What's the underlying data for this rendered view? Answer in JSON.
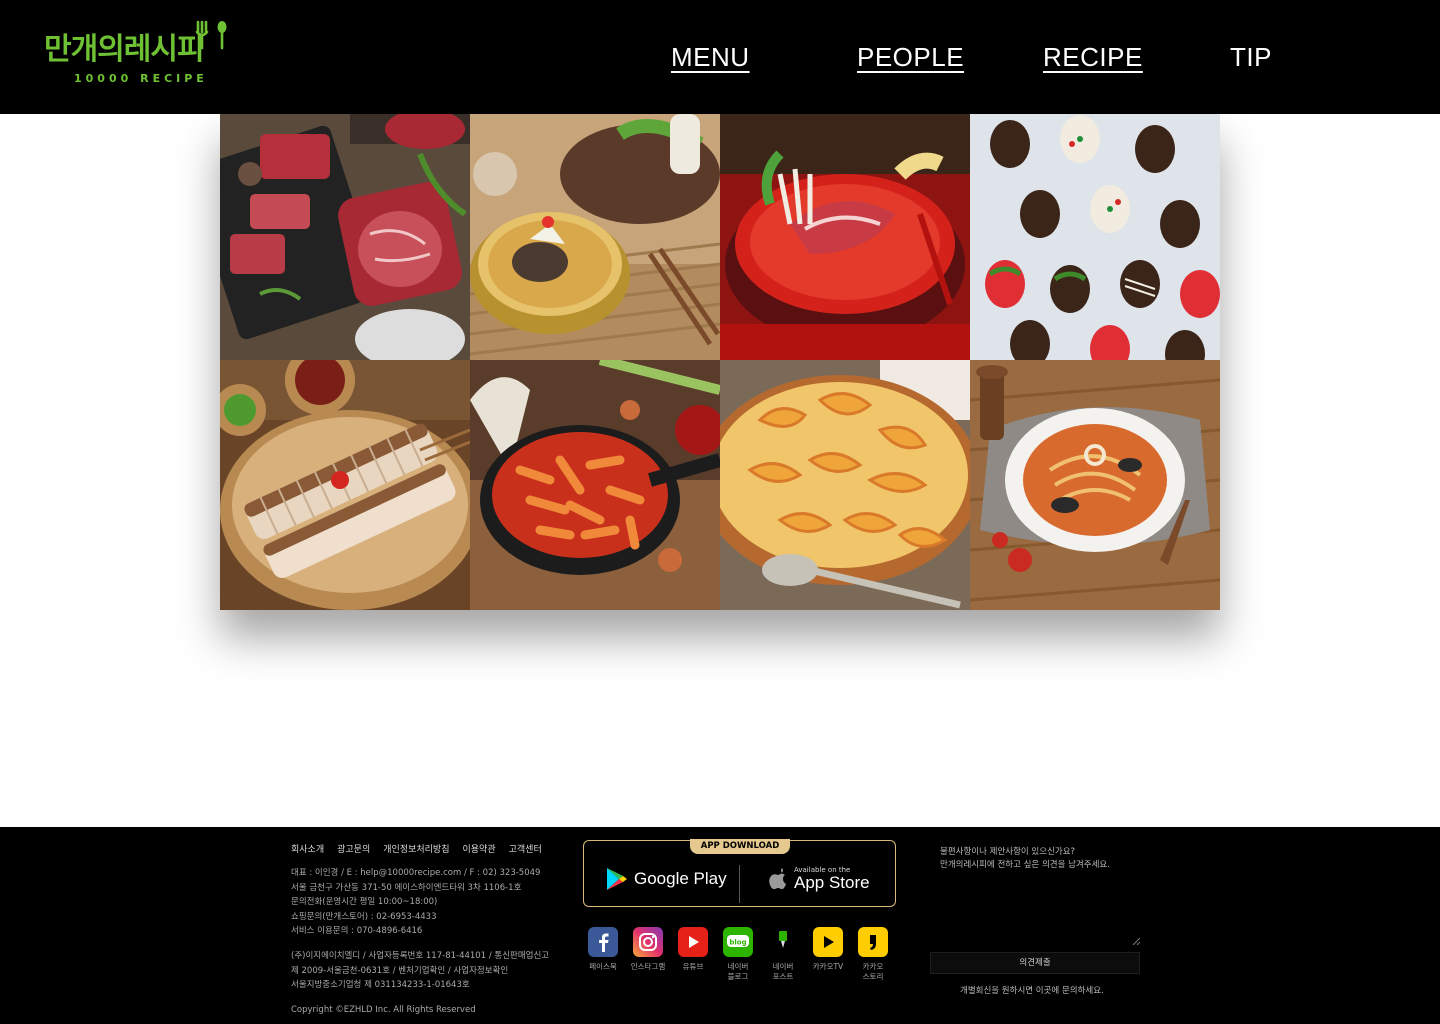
{
  "header": {
    "logo_korean": "만개의레시피",
    "logo_english": "10000 RECIPE",
    "nav": [
      "MENU",
      "PEOPLE",
      "RECIPE",
      "TIP"
    ]
  },
  "gallery": {
    "tiles": [
      "raw-beef-cuts-photo",
      "cold-noodle-naengmyeon-photo",
      "spicy-beef-hotpot-photo",
      "chocolate-dipped-strawberries-photo",
      "sliced-boiled-pork-photo",
      "tteokbokki-skillet-photo",
      "peach-tart-photo",
      "seafood-pasta-photo"
    ]
  },
  "footer": {
    "links": [
      "회사소개",
      "광고문의",
      "개인정보처리방침",
      "이용약관",
      "고객센터"
    ],
    "info_lines": [
      "대표 : 이인경 / E : help@10000recipe.com / F : 02) 323-5049",
      "서울 금천구 가산동 371-50 에이스하이엔드타워 3차 1106-1호",
      "문의전화(운영시간 평일 10:00~18:00)",
      "쇼핑문의(만개스토어) : 02-6953-4433",
      "서비스 이용문의 : 070-4896-6416"
    ],
    "company_lines": [
      "(주)이지에이치엘디 / 사업자등록번호 117-81-44101 / 통신판매업신고",
      "제 2009-서울금천-0631호 / 벤처기업확인 / 사업자정보확인",
      "서울지방중소기업청 제 031134233-1-01643호"
    ],
    "copyright": "Copyright ©EZHLD Inc. All Rights Reserved",
    "app_badge": "APP DOWNLOAD",
    "google_play": "Google Play",
    "app_store_small": "Available on the",
    "app_store_big": "App Store",
    "socials": [
      {
        "icon": "facebook-icon",
        "label": "페이스북",
        "color": "#3b5998"
      },
      {
        "icon": "instagram-icon",
        "label": "인스타그램",
        "color": "#c13584"
      },
      {
        "icon": "youtube-icon",
        "label": "유튜브",
        "color": "#e62117"
      },
      {
        "icon": "naver-blog-icon",
        "label": "네이버\n블로그",
        "color": "#2db400"
      },
      {
        "icon": "naver-post-icon",
        "label": "네이버\n포스트",
        "color": "#000000"
      },
      {
        "icon": "kakao-tv-icon",
        "label": "카카오TV",
        "color": "#ffcd00"
      },
      {
        "icon": "kakao-story-icon",
        "label": "카카오\n스토리",
        "color": "#ffcd00"
      }
    ],
    "feedback_question_1": "불편사항이나 제안사항이 있으신가요?",
    "feedback_question_2": "만개의레시피에 전하고 싶은 의견을 남겨주세요.",
    "feedback_button": "의견제출",
    "feedback_note": "개별회신을 원하시면 이곳에 문의하세요."
  }
}
